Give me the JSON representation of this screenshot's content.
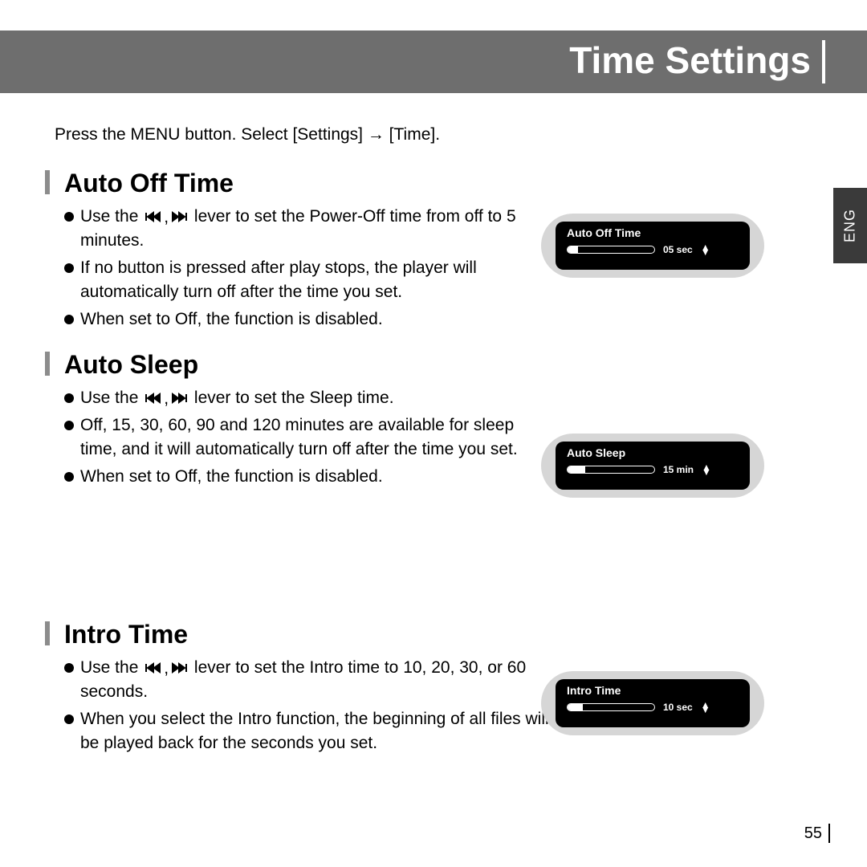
{
  "header": {
    "title": "Time Settings"
  },
  "intro": "Press the MENU button. Select [Settings] → [Time].",
  "lang_tab": "ENG",
  "sections": {
    "auto_off": {
      "heading": "Auto Off Time",
      "b1a": "Use the ",
      "b1b": " lever to set the Power-Off time from off to 5 minutes.",
      "b2": "If no button is pressed after play stops, the player will automatically turn off after the time you set.",
      "b3": "When set to Off, the function is disabled.",
      "device_label": "Auto Off Time",
      "device_value": "05 sec"
    },
    "auto_sleep": {
      "heading": "Auto Sleep",
      "b1a": "Use the ",
      "b1b": " lever to set the Sleep time.",
      "b2": "Off, 15, 30, 60, 90 and 120 minutes are available for sleep time, and it will automatically turn off after the time you set.",
      "b3": "When set to Off, the function is disabled.",
      "device_label": "Auto Sleep",
      "device_value": "15 min"
    },
    "intro_time": {
      "heading": "Intro Time",
      "b1a": "Use the ",
      "b1b": " lever to set the Intro time to 10, 20, 30, or 60 seconds.",
      "b2": "When you select the Intro function, the beginning of all files will be played back for the seconds you set.",
      "device_label": "Intro Time",
      "device_value": "10 sec"
    }
  },
  "page_number": "55",
  "icons": {
    "prev": "skip-back-icon",
    "next": "skip-forward-icon",
    "comma": ","
  }
}
